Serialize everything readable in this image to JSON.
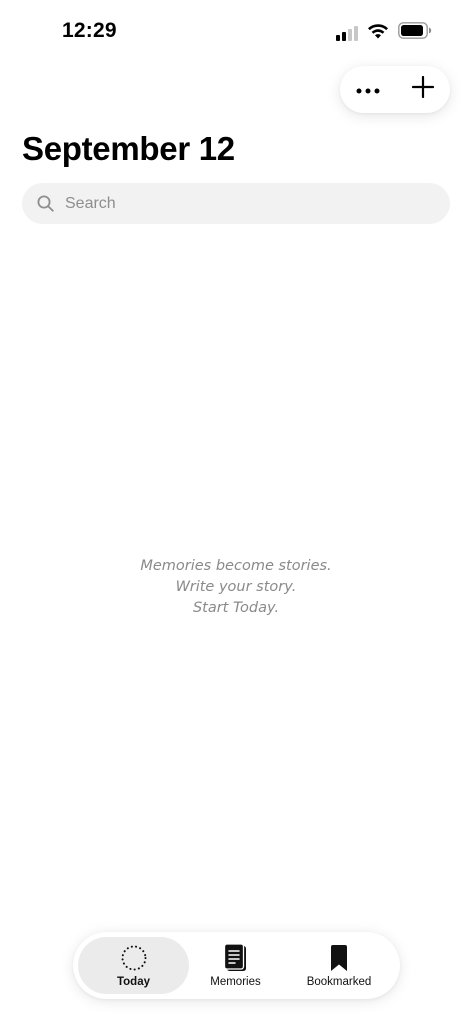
{
  "status_bar": {
    "time": "12:29",
    "icons": [
      "cellular-signal-icon",
      "wifi-icon",
      "battery-icon"
    ]
  },
  "top_actions": {
    "more_icon": "ellipsis-icon",
    "add_icon": "plus-icon"
  },
  "header": {
    "title": "September 12"
  },
  "search": {
    "placeholder": "Search",
    "value": "",
    "icon": "search-icon"
  },
  "empty_state": {
    "lines": [
      "Memories become stories.",
      "Write your story.",
      "Start Today."
    ]
  },
  "tab_bar": {
    "tabs": [
      {
        "label": "Today",
        "icon": "dotted-circle-icon",
        "active": true
      },
      {
        "label": "Memories",
        "icon": "journal-icon",
        "active": false
      },
      {
        "label": "Bookmarked",
        "icon": "bookmark-icon",
        "active": false
      }
    ]
  },
  "colors": {
    "background": "#ffffff",
    "search_background": "#f2f2f2",
    "active_tab_background": "#ebebeb",
    "muted_text": "#8a8a8a",
    "primary_text": "#000000"
  }
}
